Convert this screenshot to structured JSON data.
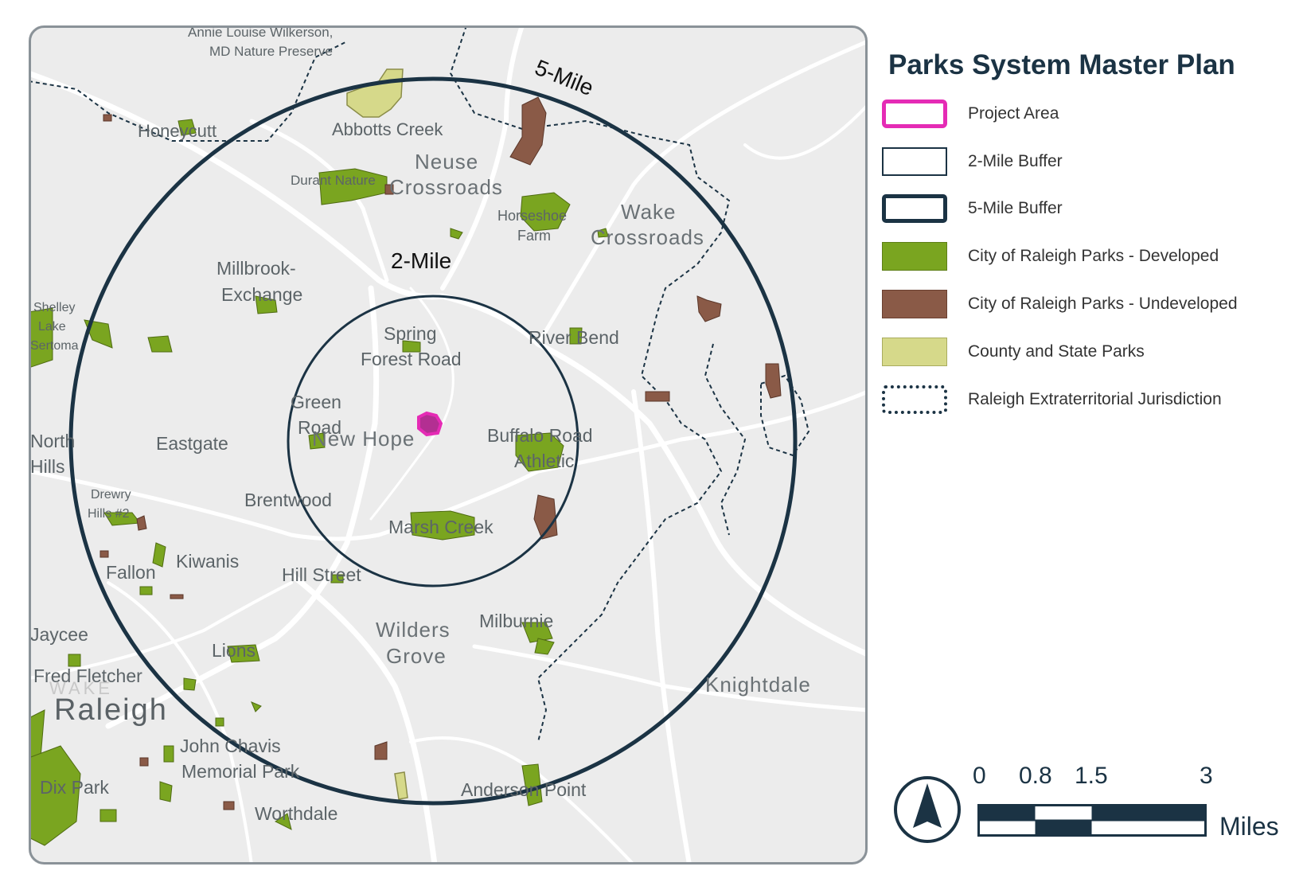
{
  "title": "Parks System Master Plan",
  "legend": [
    {
      "label": "Project Area",
      "style": "project",
      "color": "#e52bb5"
    },
    {
      "label": "2-Mile Buffer",
      "style": "buffer2",
      "color": "#1b3344"
    },
    {
      "label": "5-Mile Buffer",
      "style": "buffer5",
      "color": "#1b3344"
    },
    {
      "label": "City of Raleigh Parks - Developed",
      "style": "developed",
      "color": "#7aa520"
    },
    {
      "label": "City of Raleigh Parks - Undeveloped",
      "style": "undeveloped",
      "color": "#8a5a47"
    },
    {
      "label": "County and State Parks",
      "style": "county",
      "color": "#d6d98a"
    },
    {
      "label": "Raleigh Extraterritorial Jurisdiction",
      "style": "etj",
      "color": "#1b3344"
    }
  ],
  "buffers": {
    "two_mile_label": "2-Mile",
    "five_mile_label": "5-Mile"
  },
  "places": {
    "annie_1": "Annie Louise Wilkerson,",
    "annie_2": "MD Nature Preserve",
    "honeycutt": "Honeycutt",
    "abbotts_creek": "Abbotts Creek",
    "neuse_1": "Neuse",
    "neuse_2": "Crossroads",
    "durant": "Durant Nature",
    "horseshoe_1": "Horseshoe",
    "horseshoe_2": "Farm",
    "wake_1": "Wake",
    "wake_2": "Crossroads",
    "millbrook_1": "Millbrook-",
    "millbrook_2": "Exchange",
    "shelley_1": "Shelley",
    "shelley_2": "Lake",
    "shelley_3": "Sertoma",
    "spring_1": "Spring",
    "spring_2": "Forest Road",
    "river_bend": "River Bend",
    "green_1": "Green",
    "green_2": "Road",
    "new_hope": "New Hope",
    "buffalo_1": "Buffalo Road",
    "buffalo_2": "Athletic",
    "north_hills_1": "North",
    "north_hills_2": "Hills",
    "eastgate": "Eastgate",
    "drewry_1": "Drewry",
    "drewry_2": "Hills #2",
    "brentwood": "Brentwood",
    "marsh_creek": "Marsh Creek",
    "kiwanis": "Kiwanis",
    "fallon": "Fallon",
    "hill_street": "Hill Street",
    "jaycee": "Jaycee",
    "wilders_1": "Wilders",
    "wilders_2": "Grove",
    "milburnie": "Milburnie",
    "lions": "Lions",
    "fred_fletcher": "Fred Fletcher",
    "wake": "WAKE",
    "raleigh": "Raleigh",
    "knightdale": "Knightdale",
    "john_chavis_1": "John Chavis",
    "john_chavis_2": "Memorial Park",
    "dix_park": "Dix Park",
    "anderson_point": "Anderson Point",
    "worthdale": "Worthdale"
  },
  "scale_bar": {
    "ticks": [
      "0",
      "0.8",
      "1.5",
      "3"
    ],
    "unit": "Miles"
  },
  "north_arrow": "north-arrow-icon"
}
